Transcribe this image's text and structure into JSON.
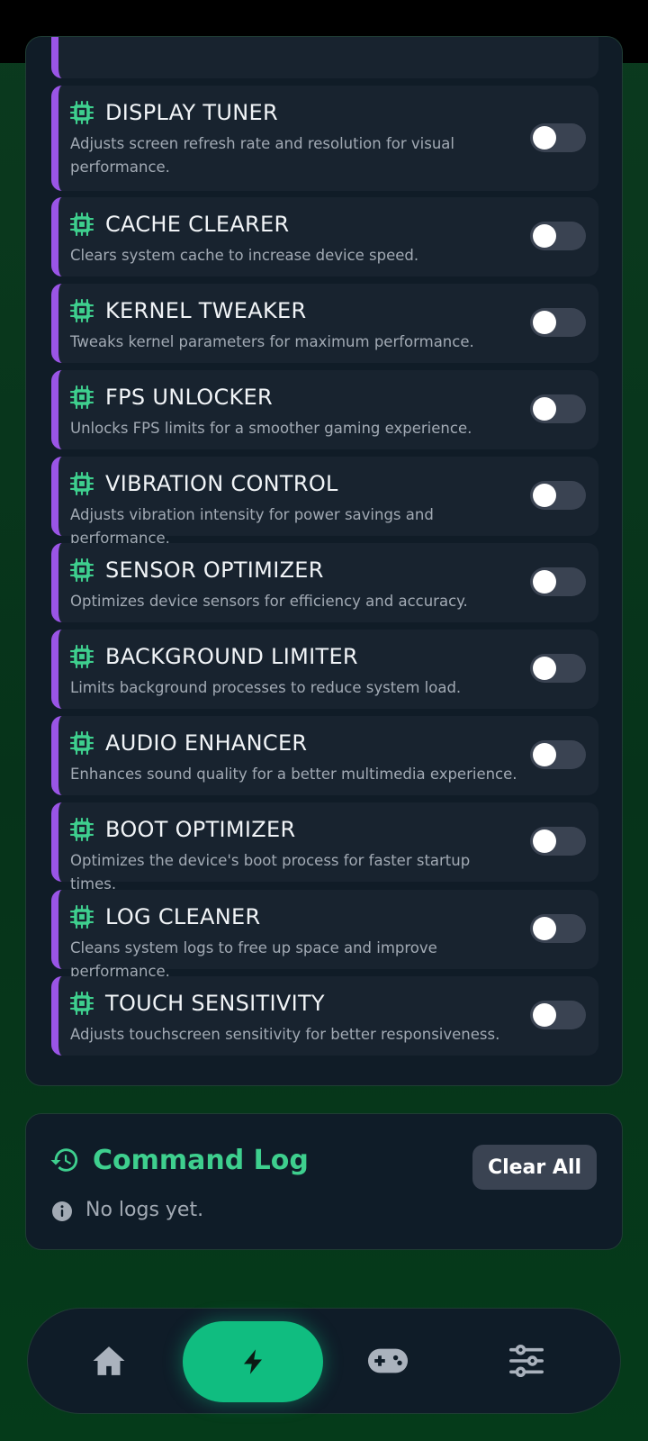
{
  "colors": {
    "accent_green": "#3ecf8e",
    "nav_active": "#10bd80",
    "card_border": "#9a55e6",
    "toggle_off": "#3a4352"
  },
  "tweaks": [
    {
      "title": "DISPLAY TUNER",
      "description": "Adjusts screen refresh rate and resolution for visual performance.",
      "enabled": false
    },
    {
      "title": "CACHE CLEARER",
      "description": "Clears system cache to increase device speed.",
      "enabled": false
    },
    {
      "title": "KERNEL TWEAKER",
      "description": "Tweaks kernel parameters for maximum performance.",
      "enabled": false
    },
    {
      "title": "FPS UNLOCKER",
      "description": "Unlocks FPS limits for a smoother gaming experience.",
      "enabled": false
    },
    {
      "title": "VIBRATION CONTROL",
      "description": "Adjusts vibration intensity for power savings and performance.",
      "enabled": false
    },
    {
      "title": "SENSOR OPTIMIZER",
      "description": "Optimizes device sensors for efficiency and accuracy.",
      "enabled": false
    },
    {
      "title": "BACKGROUND LIMITER",
      "description": "Limits background processes to reduce system load.",
      "enabled": false
    },
    {
      "title": "AUDIO ENHANCER",
      "description": "Enhances sound quality for a better multimedia experience.",
      "enabled": false
    },
    {
      "title": "BOOT OPTIMIZER",
      "description": "Optimizes the device's boot process for faster startup times.",
      "enabled": false
    },
    {
      "title": "LOG CLEANER",
      "description": "Cleans system logs to free up space and improve performance.",
      "enabled": false
    },
    {
      "title": "TOUCH SENSITIVITY",
      "description": "Adjusts touchscreen sensitivity for better responsiveness.",
      "enabled": false
    }
  ],
  "command_log": {
    "title": "Command Log",
    "clear_label": "Clear All",
    "empty_text": "No logs yet."
  },
  "nav": {
    "items": [
      "home-icon",
      "bolt-icon",
      "gamepad-icon",
      "sliders-icon"
    ],
    "active": "bolt-icon"
  }
}
